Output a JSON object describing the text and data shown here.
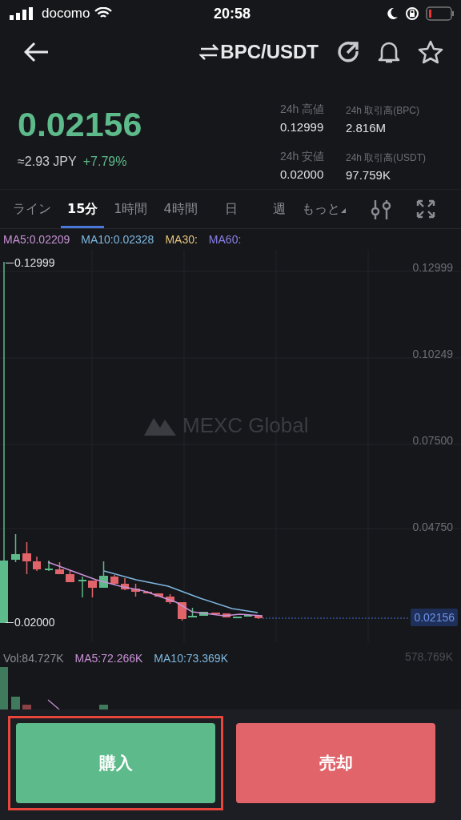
{
  "status_bar": {
    "carrier": "docomo",
    "time": "20:58"
  },
  "header": {
    "pair": "BPC/USDT"
  },
  "ticker": {
    "price": "0.02156",
    "fiat": "≈2.93 JPY",
    "change": "+7.79%",
    "stats": [
      {
        "label": "24h 高値",
        "value": "0.12999"
      },
      {
        "label": "24h 取引高(BPC)",
        "value": "2.816M"
      },
      {
        "label": "24h 安値",
        "value": "0.02000"
      },
      {
        "label": "24h 取引高(USDT)",
        "value": "97.759K"
      }
    ]
  },
  "intervals": [
    {
      "label": "ライン",
      "selected": false
    },
    {
      "label": "15分",
      "selected": true
    },
    {
      "label": "1時間",
      "selected": false
    },
    {
      "label": "4時間",
      "selected": false
    },
    {
      "label": "日",
      "selected": false
    },
    {
      "label": "週",
      "selected": false
    },
    {
      "label": "もっと",
      "selected": false
    }
  ],
  "ma_legend": [
    {
      "label": "MA5:0.02209",
      "color": "#c991d6"
    },
    {
      "label": "MA10:0.02328",
      "color": "#7fb8e0"
    },
    {
      "label": "MA30:",
      "color": "#e6c47c"
    },
    {
      "label": "MA60:",
      "color": "#8a80e6"
    }
  ],
  "chart": {
    "watermark": "MEXC Global",
    "y_labels": [
      "0.12999",
      "0.10249",
      "0.07500",
      "0.04750"
    ],
    "high_marker": "0.12999",
    "low_marker": "0.02000",
    "last_price": "0.02156"
  },
  "volume_legend": [
    {
      "label": "Vol:84.727K",
      "color": "#8a8d93"
    },
    {
      "label": "MA5:72.266K",
      "color": "#c991d6"
    },
    {
      "label": "MA10:73.369K",
      "color": "#7fb8e0"
    }
  ],
  "volume_axis": "578.769K",
  "actions": [
    {
      "kind": "buy",
      "label": "購入",
      "highlighted": true
    },
    {
      "kind": "sell",
      "label": "売却",
      "highlighted": false
    }
  ]
}
